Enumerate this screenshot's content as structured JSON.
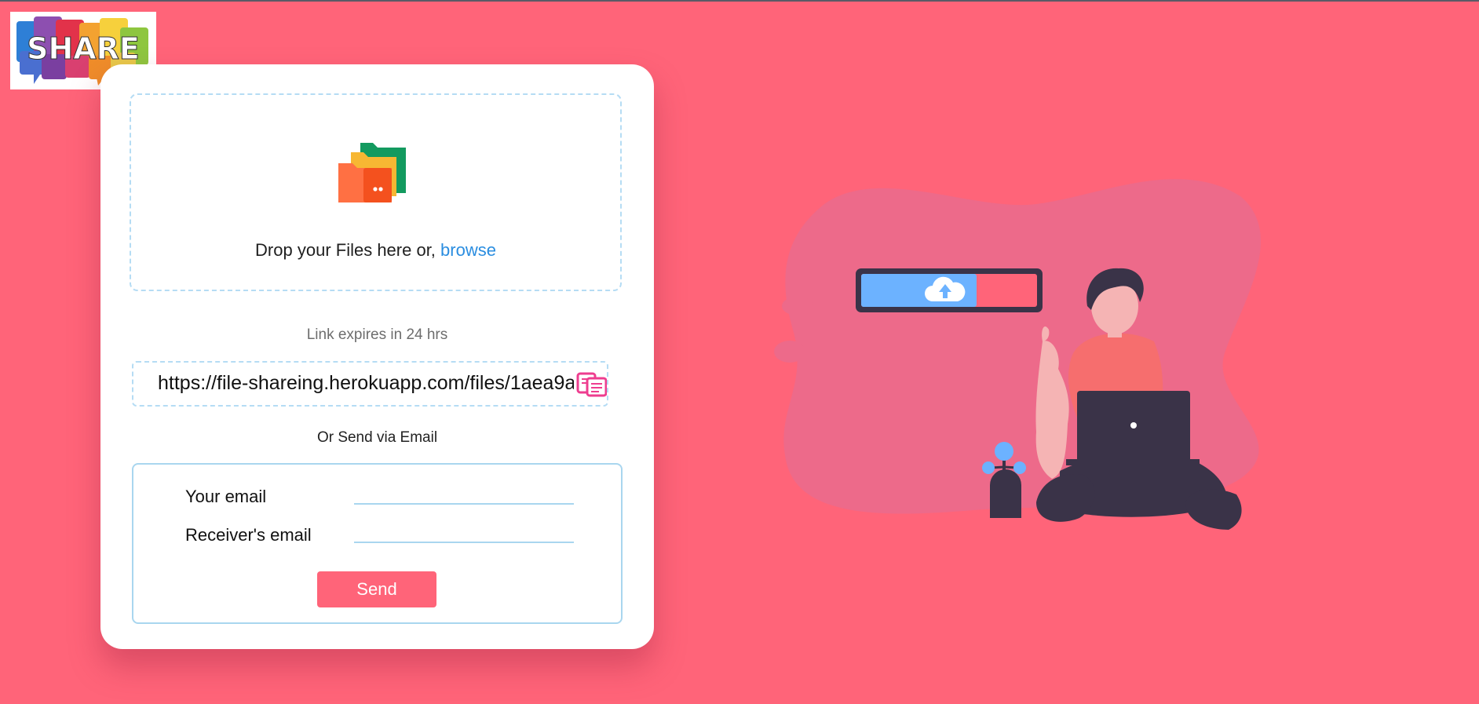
{
  "app": {
    "logo_text": "SHARE",
    "brand_color": "#ff6479"
  },
  "upload": {
    "drop_text": "Drop your Files here or, ",
    "browse_label": "browse",
    "icon": "folders-icon"
  },
  "share": {
    "expire_text": "Link expires in 24 hrs",
    "link": "https://file-shareing.herokuapp.com/files/1aea9a",
    "copy_icon": "copy-icon"
  },
  "email": {
    "heading": "Or Send via Email",
    "sender_label": "Your email",
    "sender_value": "",
    "receiver_label": "Receiver's email",
    "receiver_value": "",
    "send_label": "Send"
  },
  "illustration": {
    "name": "person-uploading-illustration",
    "upload_progress": 0.6
  }
}
